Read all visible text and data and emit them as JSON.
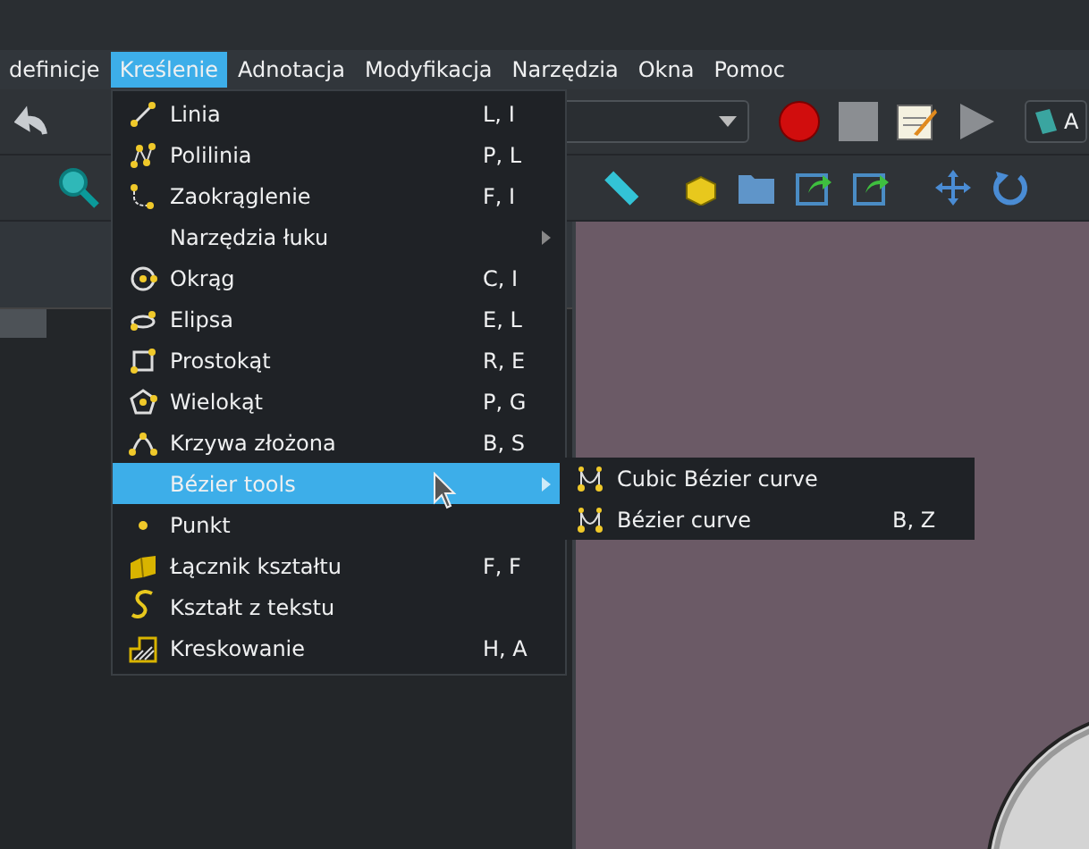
{
  "menubar": [
    {
      "label": "definicje",
      "selected": false
    },
    {
      "label": "Kreślenie",
      "selected": true
    },
    {
      "label": "Adnotacja",
      "selected": false
    },
    {
      "label": "Modyfikacja",
      "selected": false
    },
    {
      "label": "Narzędzia",
      "selected": false
    },
    {
      "label": "Okna",
      "selected": false
    },
    {
      "label": "Pomoc",
      "selected": false
    }
  ],
  "toolbar": {
    "cut_button": "A"
  },
  "menu": [
    {
      "label": "Linia",
      "shortcut": "L, I",
      "selected": false,
      "submenu": false
    },
    {
      "label": "Polilinia",
      "shortcut": "P, L",
      "selected": false,
      "submenu": false
    },
    {
      "label": "Zaokrąglenie",
      "shortcut": "F, I",
      "selected": false,
      "submenu": false
    },
    {
      "label": "Narzędzia łuku",
      "selected": false,
      "submenu": true
    },
    {
      "label": "Okrąg",
      "shortcut": "C, I",
      "selected": false,
      "submenu": false
    },
    {
      "label": "Elipsa",
      "shortcut": "E, L",
      "selected": false,
      "submenu": false
    },
    {
      "label": "Prostokąt",
      "shortcut": "R, E",
      "selected": false,
      "submenu": false
    },
    {
      "label": "Wielokąt",
      "shortcut": "P, G",
      "selected": false,
      "submenu": false
    },
    {
      "label": "Krzywa złożona",
      "shortcut": "B, S",
      "selected": false,
      "submenu": false
    },
    {
      "label": "Bézier tools",
      "selected": true,
      "submenu": true
    },
    {
      "label": "Punkt",
      "selected": false,
      "submenu": false
    },
    {
      "label": "Łącznik kształtu",
      "shortcut": "F, F",
      "selected": false,
      "submenu": false
    },
    {
      "label": "Kształt z tekstu",
      "selected": false,
      "submenu": false
    },
    {
      "label": "Kreskowanie",
      "shortcut": "H, A",
      "selected": false,
      "submenu": false
    }
  ],
  "submenu": [
    {
      "label": "Cubic Bézier curve",
      "selected": false
    },
    {
      "label": "Bézier curve",
      "shortcut": "B, Z",
      "selected": false
    }
  ]
}
